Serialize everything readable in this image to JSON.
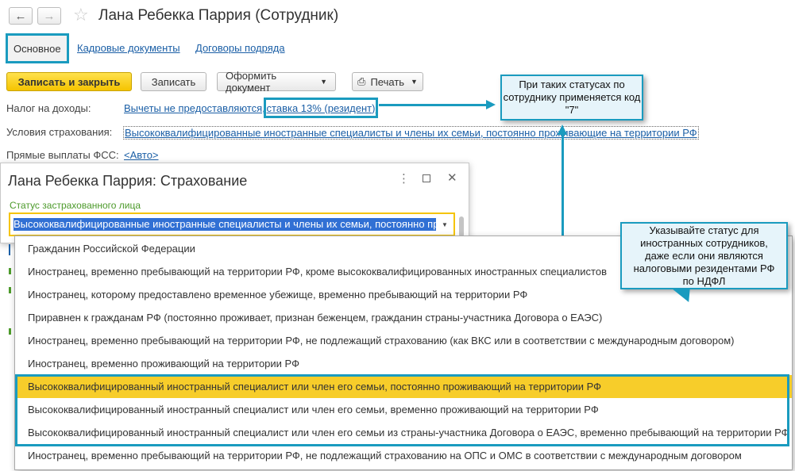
{
  "window": {
    "title": "Лана Ребекка Паррия (Сотрудник)",
    "back_icon": "arrow-left-icon",
    "forward_icon": "arrow-right-icon",
    "favorite_icon": "star-icon"
  },
  "tabs": [
    {
      "label": "Основное",
      "active": true
    },
    {
      "label": "Кадровые документы",
      "active": false
    },
    {
      "label": "Договоры подряда",
      "active": false
    }
  ],
  "toolbar": {
    "save_close": "Записать и закрыть",
    "save": "Записать",
    "create_document": "Оформить документ",
    "print": "Печать"
  },
  "fields": {
    "tax_label": "Налог на доходы:",
    "tax_value_part1": "Вычеты не предоставляются,",
    "tax_value_part2": "ставка 13% (резидент)",
    "insurance_label": "Условия страхования:",
    "insurance_value": "Высококвалифицированные иностранные специалисты и члены их семьи, постоянно проживающие на территории РФ",
    "fss_label": "Прямые выплаты ФСС:",
    "fss_value": "<Авто>"
  },
  "dialog": {
    "title": "Лана Ребекка Паррия: Страхование",
    "status_label": "Статус застрахованного лица",
    "status_value": "Высококвалифицированные иностранные специалисты и члены их семьи, постоянно про"
  },
  "dropdown": {
    "items": [
      "Гражданин Российской Федерации",
      "Иностранец, временно пребывающий на территории РФ, кроме высококвалифицированных иностранных специалистов",
      "Иностранец, которому предоставлено временное убежище, временно пребывающий на территории РФ",
      "Приравнен к гражданам РФ (постоянно проживает, признан беженцем, гражданин страны-участника Договора о ЕАЭС)",
      "Иностранец, временно пребывающий на территории РФ, не подлежащий страхованию (как ВКС или в соответствии с международным договором)",
      "Иностранец, временно проживающий на территории РФ",
      "Высококвалифицированный иностранный специалист или член его семьи, постоянно проживающий на территории РФ",
      "Высококвалифицированный иностранный специалист или член его семьи, временно проживающий на территории РФ",
      "Высококвалифицированный иностранный специалист или член его семьи из страны-участника Договора о ЕАЭС, временно пребывающий на территории РФ",
      "Иностранец, временно пребывающий на территории РФ, не подлежащий страхованию на ОПС и ОМС в соответствии с международным договором"
    ],
    "selected_index": 6
  },
  "callouts": {
    "top": "При таких статусах по сотруднику применяется код \"7\"",
    "right": "Указывайте статус для иностранных сотрудников, даже если они являются налоговыми резидентами РФ по НДФЛ"
  },
  "colors": {
    "accent": "#1a9bbf",
    "primary_button": "#f5c400",
    "selection": "#f7cd2a",
    "link": "#1b5fa6"
  }
}
